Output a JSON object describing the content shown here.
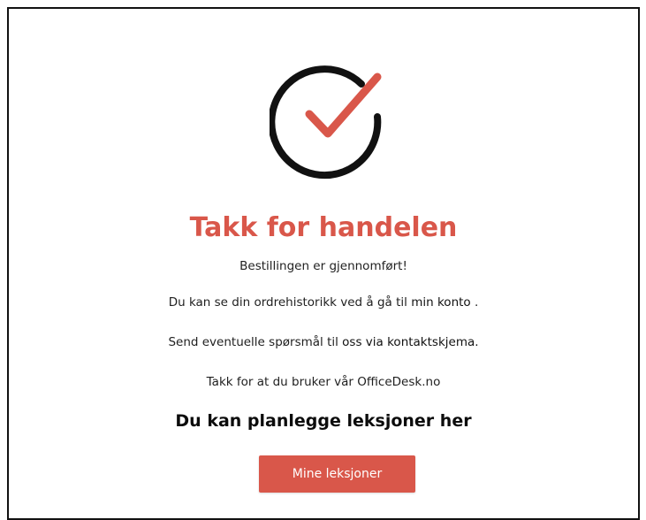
{
  "colors": {
    "accent": "#d9574a",
    "text": "#1f1f1f",
    "icon_ring": "#111111"
  },
  "icon": {
    "name": "checkmark-circle-icon"
  },
  "confirmation": {
    "title": "Takk for handelen",
    "order_complete": "Bestillingen er gjennomført!",
    "history_prefix": "Du kan se din ordrehistorikk ved å gå til",
    "history_link": "min konto",
    "history_suffix": " .",
    "questions_prefix": "Send eventuelle spørsmål til",
    "questions_link": "oss via kontaktskjema.",
    "thanks": "Takk for at du bruker vår OfficeDesk.no"
  },
  "lessons": {
    "heading": "Du kan planlegge leksjoner her",
    "button_label": "Mine leksjoner"
  }
}
